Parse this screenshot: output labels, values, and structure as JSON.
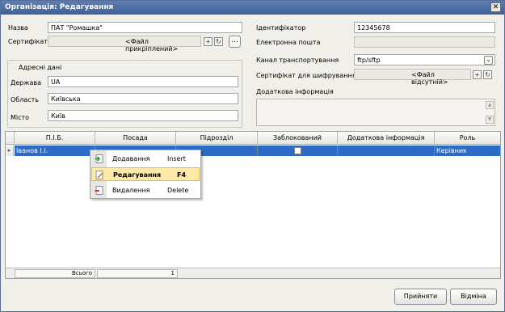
{
  "window": {
    "title": "Організація: Редагування",
    "close_glyph": "✕"
  },
  "form": {
    "name_label": "Назва",
    "name_value": "ПАТ \"Ромашка\"",
    "cert_label": "Сертифікат",
    "cert_value": "<Файл прикріплений>",
    "address_group_title": "Адресні дані",
    "country_label": "Держава",
    "country_value": "UA",
    "region_label": "Область",
    "region_value": "Київська",
    "city_label": "Місто",
    "city_value": "Київ",
    "id_label": "Ідентифікатор",
    "id_value": "12345678",
    "email_label": "Електронна пошта",
    "email_value": "",
    "transport_label": "Канал транспортування",
    "transport_value": "ftp/sftp",
    "enc_cert_label": "Сертифікат для шифрування",
    "enc_cert_value": "<Файл відсутній>",
    "extra_label": "Додаткова інформація",
    "dots_glyph": "...",
    "plus_glyph": "+",
    "refresh_glyph": "↻",
    "dropdown_glyph": "⌄"
  },
  "grid": {
    "headers": [
      "П.І.Б.",
      "Посада",
      "Підрозділ",
      "Заблокований",
      "Додаткова інформація",
      "Роль"
    ],
    "row": {
      "indicator": "▸",
      "name": "Іванов І.І.",
      "position": "",
      "department": "",
      "blocked": false,
      "extra": "",
      "role": "Керівник"
    },
    "footer_total_label": "Всього",
    "footer_total_value": "1"
  },
  "context_menu": {
    "items": [
      {
        "label": "Додавання",
        "shortcut": "Insert",
        "icon": "add-icon"
      },
      {
        "label": "Редагування",
        "shortcut": "F4",
        "icon": "edit-icon",
        "selected": true
      },
      {
        "label": "Видалення",
        "shortcut": "Delete",
        "icon": "delete-icon"
      }
    ]
  },
  "buttons": {
    "accept": "Прийняти",
    "cancel": "Відміна"
  },
  "colors": {
    "title_bar": "#4a6aa5",
    "selection": "#2d6cc6",
    "menu_highlight": "#fde9a8"
  }
}
